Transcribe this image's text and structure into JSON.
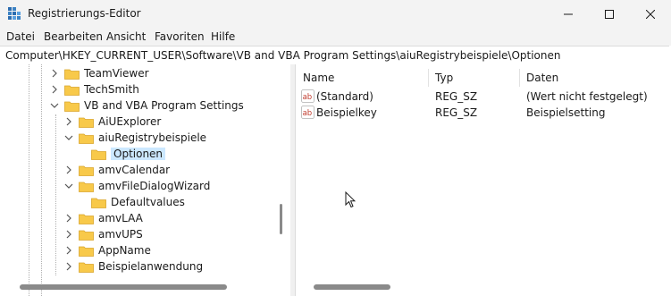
{
  "window": {
    "title": "Registrierungs-Editor"
  },
  "menu": [
    "Datei",
    "Bearbeiten",
    "Ansicht",
    "Favoriten",
    "Hilfe"
  ],
  "address": "Computer\\HKEY_CURRENT_USER\\Software\\VB and VBA Program Settings\\aiuRegistrybeispiele\\Optionen",
  "tree": {
    "items": [
      {
        "label": "TeamViewer",
        "expanded": false,
        "selected": false
      },
      {
        "label": "TechSmith",
        "expanded": false,
        "selected": false
      },
      {
        "label": "VB and VBA Program Settings",
        "expanded": true,
        "selected": false
      },
      {
        "label": "AiUExplorer",
        "expanded": false,
        "selected": false
      },
      {
        "label": "aiuRegistrybeispiele",
        "expanded": true,
        "selected": false
      },
      {
        "label": "Optionen",
        "expanded": false,
        "selected": true
      },
      {
        "label": "amvCalendar",
        "expanded": false,
        "selected": false
      },
      {
        "label": "amvFileDialogWizard",
        "expanded": true,
        "selected": false
      },
      {
        "label": "Defaultvalues",
        "expanded": false,
        "selected": false
      },
      {
        "label": "amvLAA",
        "expanded": false,
        "selected": false
      },
      {
        "label": "amvUPS",
        "expanded": false,
        "selected": false
      },
      {
        "label": "AppName",
        "expanded": false,
        "selected": false
      },
      {
        "label": "Beispielanwendung",
        "expanded": false,
        "selected": false
      }
    ]
  },
  "list": {
    "columns": [
      "Name",
      "Typ",
      "Daten"
    ],
    "rows": [
      {
        "name": "(Standard)",
        "type": "REG_SZ",
        "data": "(Wert nicht festgelegt)"
      },
      {
        "name": "Beispielkey",
        "type": "REG_SZ",
        "data": "Beispielsetting"
      }
    ]
  },
  "colors": {
    "folder": "#f8c94a",
    "selection": "#cce8ff",
    "value_icon": "#c0392b"
  }
}
